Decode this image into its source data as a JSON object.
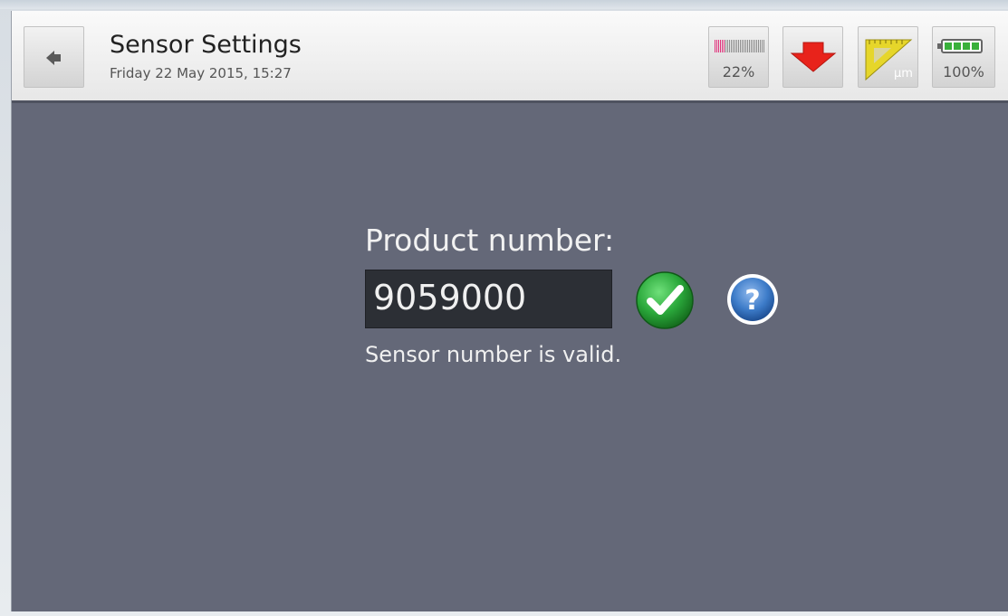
{
  "header": {
    "title": "Sensor Settings",
    "datetime": "Friday 22 May 2015, 15:27",
    "signal_pct": "22%",
    "unit_label": "µm",
    "battery_pct": "100%",
    "battery_level": 1.0,
    "signal_level": 0.22
  },
  "icons": [
    "back-arrow-icon",
    "signal-icon",
    "red-down-arrow-icon",
    "ruler-triangle-icon",
    "battery-icon",
    "check-icon",
    "help-icon"
  ],
  "colors": {
    "screen_bg": "#646878",
    "header_bg": "#f2f2f2",
    "alert_red": "#e8231b",
    "valid_green": "#2aa83b",
    "help_blue": "#3d7cc9",
    "ruler_yellow": "#e6d62a"
  },
  "content": {
    "product_label": "Product number:",
    "product_value": "9059000",
    "status": "Sensor number is valid."
  }
}
